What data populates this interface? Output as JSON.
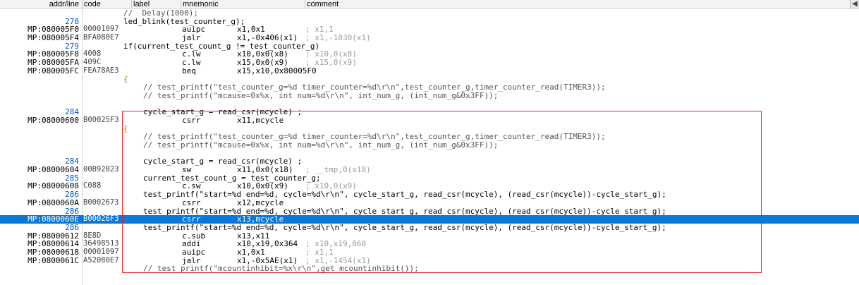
{
  "columns": {
    "addr": "addr/line",
    "code": "code",
    "label": "label",
    "mnemonic": "mnemonic",
    "comment": "comment"
  },
  "rows": [
    {
      "type": "src",
      "text": "//  Delay(1000);"
    },
    {
      "type": "line",
      "num": "278",
      "text": "led_blink(test_counter_g);"
    },
    {
      "type": "asm",
      "addr": "MP:080005F0",
      "code": "00001097",
      "mnem": "auipc",
      "ops": "x1,0x1",
      "cmt": "; x1,1"
    },
    {
      "type": "asm",
      "addr": "MP:080005F4",
      "code": "BFA080E7",
      "mnem": "jalr",
      "ops": "x1,-0x406(x1)",
      "cmt": "; x1,-1030(x1)"
    },
    {
      "type": "line",
      "num": "279",
      "text": "if(current_test_count_g != test_counter_g)"
    },
    {
      "type": "asm",
      "addr": "MP:080005F8",
      "code": "4008",
      "mnem": "c.lw",
      "ops": "x10,0x0(x8)",
      "cmt": "; x10,0(x8)"
    },
    {
      "type": "asm",
      "addr": "MP:080005FA",
      "code": "409C",
      "mnem": "c.lw",
      "ops": "x15,0x0(x9)",
      "cmt": "; x15,0(x9)"
    },
    {
      "type": "asm",
      "addr": "MP:080005FC",
      "code": "FEA78AE3",
      "mnem": "beq",
      "ops": "x15,x10,0x80005F0",
      "cmt": ""
    },
    {
      "type": "brace",
      "text": "{"
    },
    {
      "type": "csrc",
      "text": "// test_printf(\"test_counter_g=%d timer_counter=%d\\r\\n\",test_counter_g,timer_counter_read(TIMER3));"
    },
    {
      "type": "csrc",
      "text": "// test_printf(\"mcause=0x%x, int num=%d\\r\\n\", int_num_g, (int_num_g&0x3FF));"
    },
    {
      "type": "blank"
    },
    {
      "type": "line2",
      "num": "284",
      "text": "cycle_start_g = read_csr(mcycle) ;"
    },
    {
      "type": "asm",
      "addr": "MP:08000600",
      "code": "B00025F3",
      "mnem": "csrr",
      "ops": "x11,mcycle",
      "cmt": ""
    },
    {
      "type": "brace",
      "text": "{"
    },
    {
      "type": "csrc",
      "text": "// test_printf(\"test_counter_g=%d timer_counter=%d\\r\\n\",test_counter_g,timer_counter_read(TIMER3));"
    },
    {
      "type": "csrc",
      "text": "// test_printf(\"mcause=0x%x, int num=%d\\r\\n\", int_num_g, (int_num_g&0x3FF));"
    },
    {
      "type": "blank"
    },
    {
      "type": "line2",
      "num": "284",
      "text": "cycle_start_g = read_csr(mcycle) ;"
    },
    {
      "type": "asm",
      "addr": "MP:08000604",
      "code": "00B92023",
      "mnem": "sw",
      "ops": "x11,0x0(x18)",
      "cmt": "; __tmp,0(x18)"
    },
    {
      "type": "line2",
      "num": "285",
      "text": "current_test_count_g = test_counter_g;"
    },
    {
      "type": "asm",
      "addr": "MP:08000608",
      "code": "C088",
      "mnem": "c.sw",
      "ops": "x10,0x0(x9)",
      "cmt": "; x10,0(x9)"
    },
    {
      "type": "line2",
      "num": "286",
      "text": "test_printf(\"start=%d end=%d, cycle=%d\\r\\n\", cycle_start_g, read_csr(mcycle), (read_csr(mcycle))-cycle_start_g);"
    },
    {
      "type": "asm",
      "addr": "MP:0800060A",
      "code": "B0002673",
      "mnem": "csrr",
      "ops": "x12,mcycle",
      "cmt": ""
    },
    {
      "type": "line2",
      "num": "286",
      "text": "test_printf(\"start=%d end=%d, cycle=%d\\r\\n\", cycle_start_g, read_csr(mcycle), (read_csr(mcycle))-cycle_start_g);"
    },
    {
      "type": "asm",
      "addr": "MP:0800060E",
      "code": "B00026F3",
      "mnem": "csrr",
      "ops": "x13,mcycle",
      "cmt": "",
      "selected": true
    },
    {
      "type": "line2",
      "num": "286",
      "text": "test_printf(\"start=%d end=%d, cycle=%d\\r\\n\", cycle_start_g, read_csr(mcycle), (read_csr(mcycle))-cycle_start_g);"
    },
    {
      "type": "asm",
      "addr": "MP:08000612",
      "code": "8E8D",
      "mnem": "c.sub",
      "ops": "x13,x11",
      "cmt": ""
    },
    {
      "type": "asm",
      "addr": "MP:08000614",
      "code": "36498513",
      "mnem": "addi",
      "ops": "x10,x19,0x364",
      "cmt": "; x10,x19,868"
    },
    {
      "type": "asm",
      "addr": "MP:08000618",
      "code": "00001097",
      "mnem": "auipc",
      "ops": "x1,0x1",
      "cmt": "; x1,1"
    },
    {
      "type": "asm",
      "addr": "MP:0800061C",
      "code": "A52080E7",
      "mnem": "jalr",
      "ops": "x1,-0x5AE(x1)",
      "cmt": "; x1,-1454(x1)"
    },
    {
      "type": "csrc",
      "text": "// test_printf(\"mcountinhibit=%x\\r\\n\",get_mcountinhibit());"
    }
  ]
}
